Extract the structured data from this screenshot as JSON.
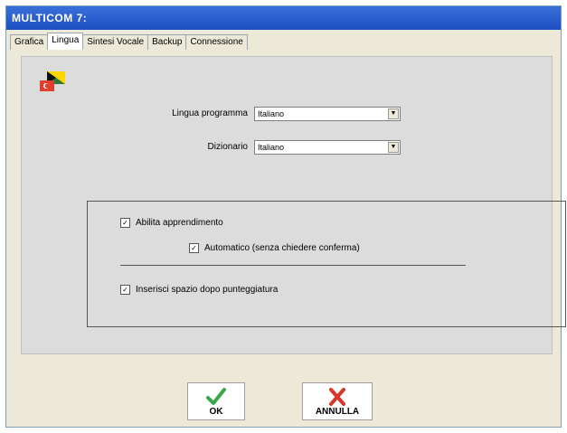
{
  "window": {
    "title": "MULTICOM 7:"
  },
  "tabs": [
    {
      "label": "Grafica",
      "active": false
    },
    {
      "label": "Lingua",
      "active": true
    },
    {
      "label": "Sintesi Vocale",
      "active": false
    },
    {
      "label": "Backup",
      "active": false
    },
    {
      "label": "Connessione",
      "active": false
    }
  ],
  "language": {
    "program_label": "Lingua programma",
    "program_value": "Italiano",
    "dictionary_label": "Dizionario",
    "dictionary_value": "Italiano"
  },
  "options": {
    "learning_label": "Abilita apprendimento",
    "learning_checked": true,
    "automatic_label": "Automatico (senza chiedere conferma)",
    "automatic_checked": true,
    "space_label": "Inserisci spazio dopo punteggiatura",
    "space_checked": true
  },
  "buttons": {
    "ok_label": "OK",
    "cancel_label": "ANNULLA"
  },
  "colors": {
    "titlebar": "#1d4fc3",
    "ok_icon": "#3aa84a",
    "cancel_icon": "#d9362b"
  }
}
